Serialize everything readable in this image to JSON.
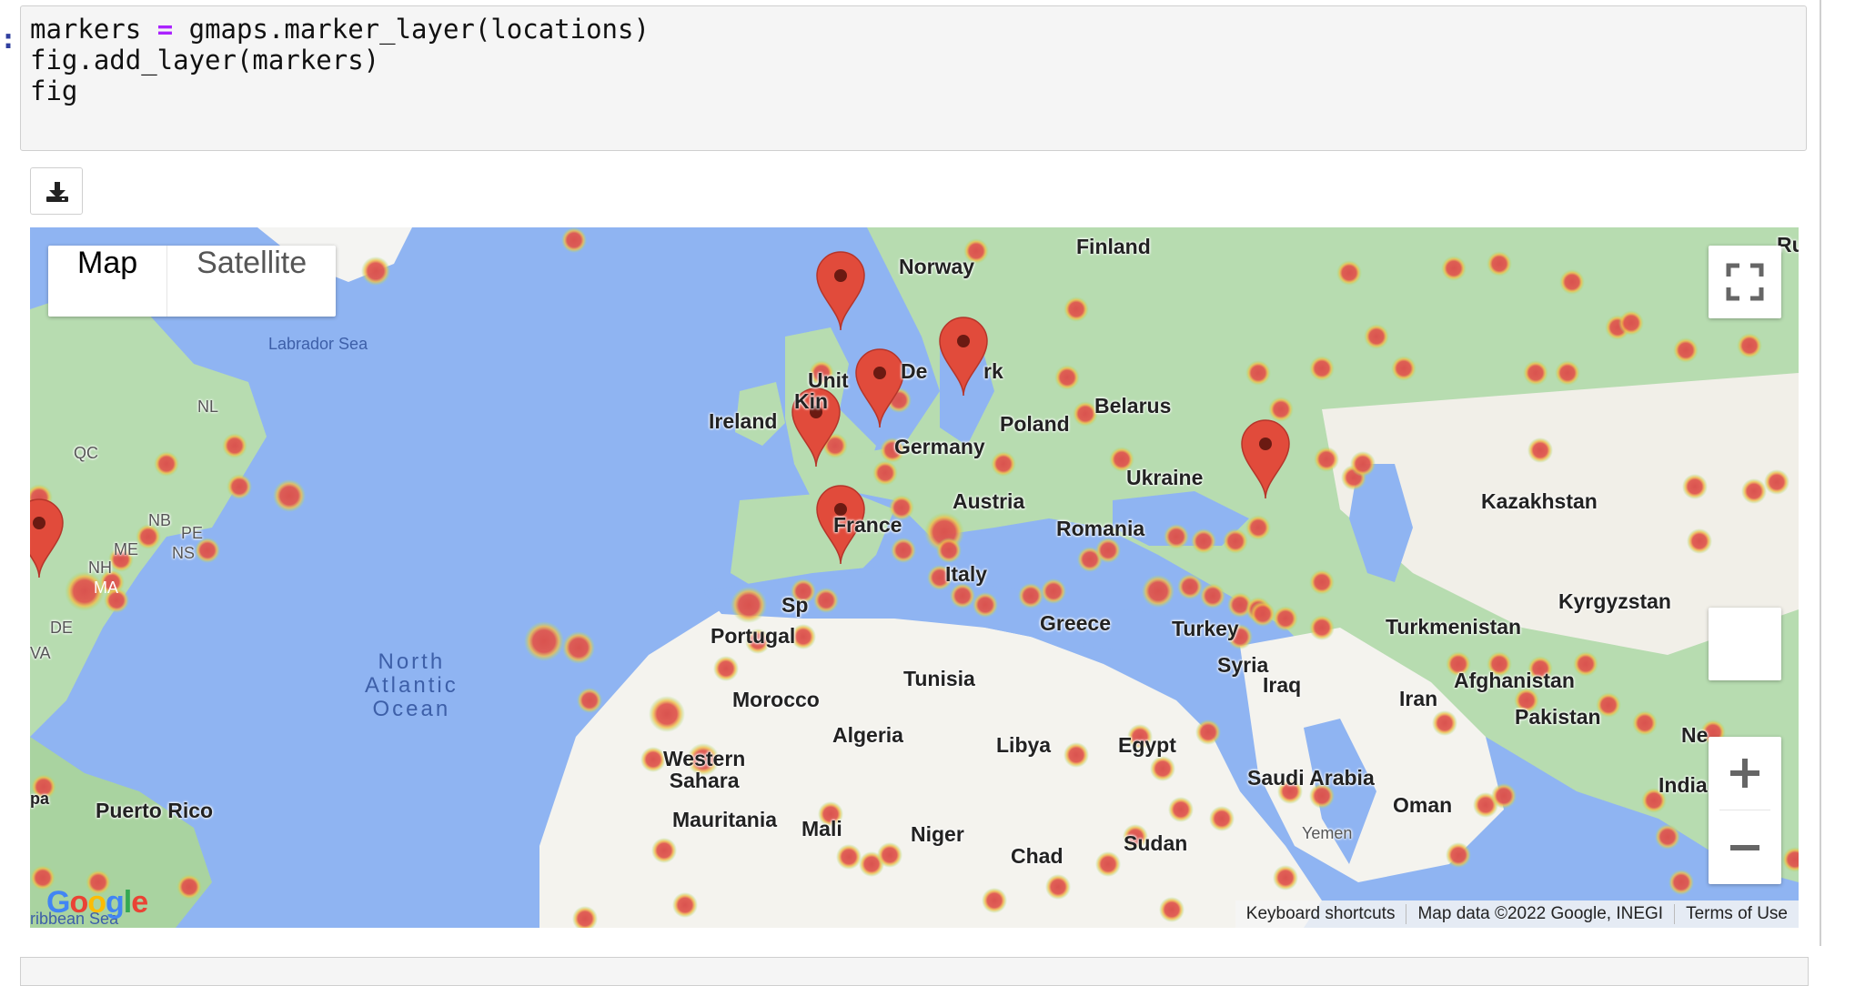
{
  "prompt_marker": ":",
  "code": {
    "lines": [
      {
        "var": "markers ",
        "op": "=",
        "rest": " gmaps.marker_layer(locations)"
      },
      {
        "text": "fig.add_layer(markers)"
      },
      {
        "text": "fig"
      }
    ]
  },
  "toolbar": {
    "download_icon": "download-icon"
  },
  "map": {
    "map_type": {
      "map_label": "Map",
      "satellite_label": "Satellite"
    },
    "controls": {
      "fullscreen_icon": "fullscreen-icon",
      "zoom_in": "+",
      "zoom_out": "−"
    },
    "labels": {
      "finland": "Finland",
      "norway": "Norway",
      "labrador_sea": "Labrador Sea",
      "nl": "NL",
      "qc": "QC",
      "ireland": "Ireland",
      "united_kingdom_1": "Unit",
      "united_kingdom_2": "Kin",
      "denmark_1": "De",
      "denmark_2": "rk",
      "belarus": "Belarus",
      "poland": "Poland",
      "germany": "Germany",
      "ukraine": "Ukraine",
      "kazakhstan": "Kazakhstan",
      "austria": "Austria",
      "france": "France",
      "romania": "Romania",
      "nb": "NB",
      "pe": "PE",
      "me": "ME",
      "ns": "NS",
      "nh": "NH",
      "ma": "MA",
      "italy": "Italy",
      "kyrgyzstan": "Kyrgyzstan",
      "spain": "Sp",
      "greece": "Greece",
      "turkey": "Turkey",
      "turkmenistan": "Turkmenistan",
      "portugal": "Portugal",
      "syria": "Syria",
      "north_atlantic_ocean": "North\nAtlantic\nOcean",
      "tunisia": "Tunisia",
      "afghanistan": "Afghanistan",
      "iraq": "Iraq",
      "iran": "Iran",
      "morocco": "Morocco",
      "pakistan": "Pakistan",
      "algeria": "Algeria",
      "libya": "Libya",
      "egypt": "Egypt",
      "nepal": "Ne",
      "western_sahara": "Western\nSahara",
      "saudi_arabia": "Saudi Arabia",
      "india": "India",
      "puerto_rico": "Puerto Rico",
      "oman": "Oman",
      "mauritania": "Mauritania",
      "mali": "Mali",
      "niger": "Niger",
      "sudan": "Sudan",
      "chad": "Chad",
      "caribbean_sea": "ribbean Sea",
      "pa": "pa",
      "va": "VA",
      "de": "DE",
      "russia_partial": "Ru",
      "yemen": "Yemen"
    },
    "logo": {
      "letters": [
        "G",
        "o",
        "o",
        "g",
        "l",
        "e"
      ],
      "colors": [
        "#4285f4",
        "#ea4335",
        "#fbbc05",
        "#4285f4",
        "#34a853",
        "#ea4335"
      ]
    },
    "attribution": {
      "shortcuts": "Keyboard shortcuts",
      "map_data": "Map data ©2022 Google, INEGI",
      "terms": "Terms of Use"
    },
    "marker_color": "#e14b3b",
    "heat_color": "#d9534f",
    "water_color": "#8fb4f2",
    "land_color": "#b7dcb0"
  }
}
